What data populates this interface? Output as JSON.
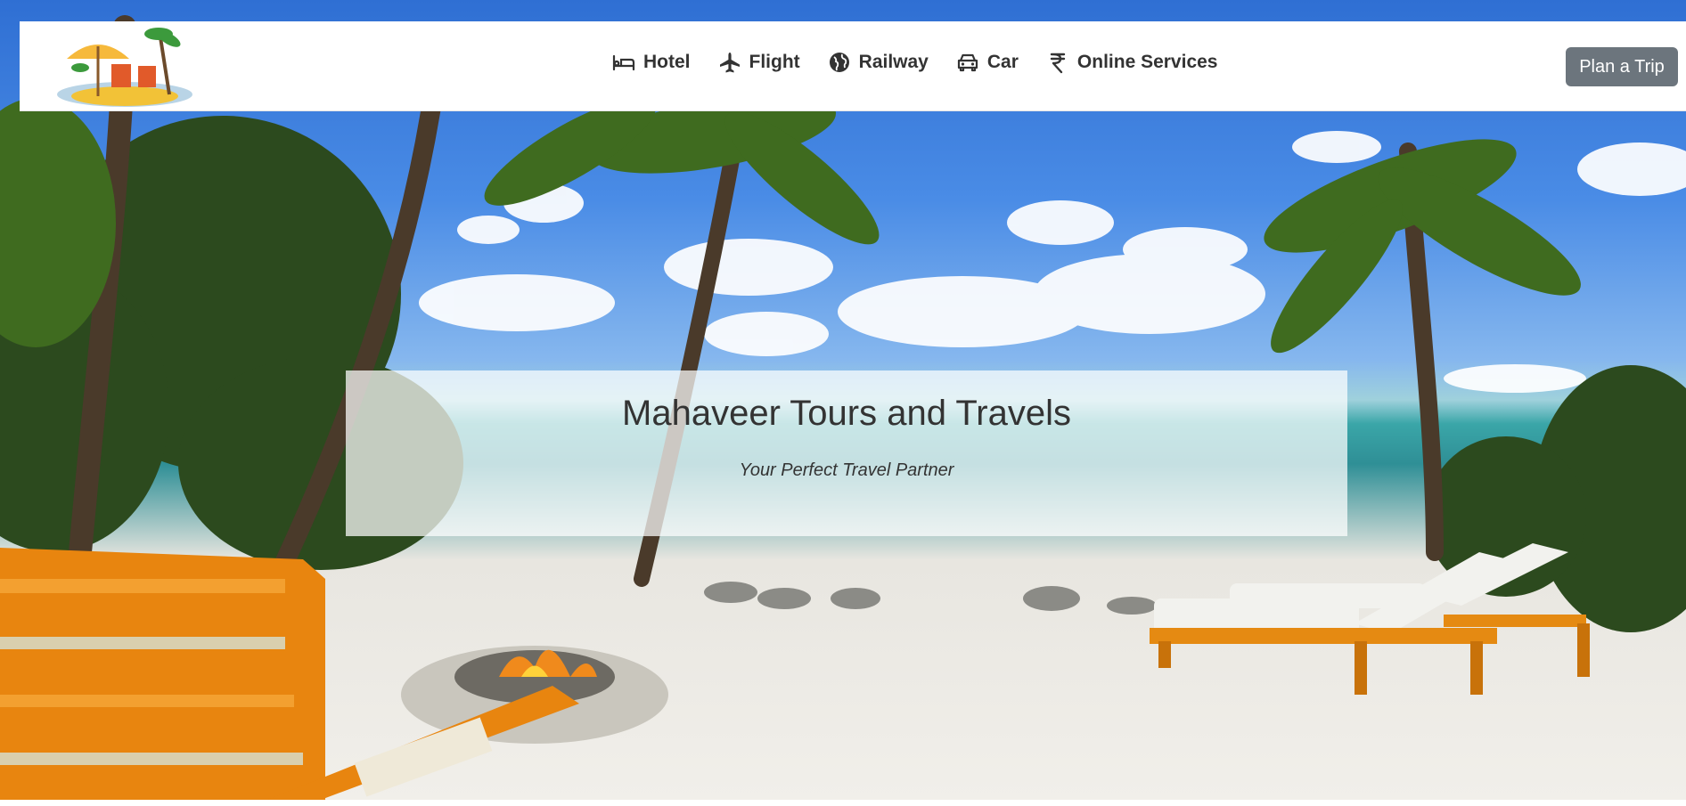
{
  "brand": {
    "logo_icon": "beach-umbrella-logo"
  },
  "nav": {
    "items": [
      {
        "label": "Hotel",
        "icon": "bed-icon"
      },
      {
        "label": "Flight",
        "icon": "airplane-icon"
      },
      {
        "label": "Railway",
        "icon": "globe-icon"
      },
      {
        "label": "Car",
        "icon": "car-icon"
      },
      {
        "label": "Online Services",
        "icon": "rupee-icon"
      }
    ],
    "cta_label": "Plan a Trip"
  },
  "hero": {
    "title": "Mahaveer Tours and Travels",
    "tagline": "Your Perfect Travel Partner"
  },
  "colors": {
    "nav_text": "#333333",
    "cta_bg": "#6c757d",
    "cta_text": "#ffffff"
  }
}
